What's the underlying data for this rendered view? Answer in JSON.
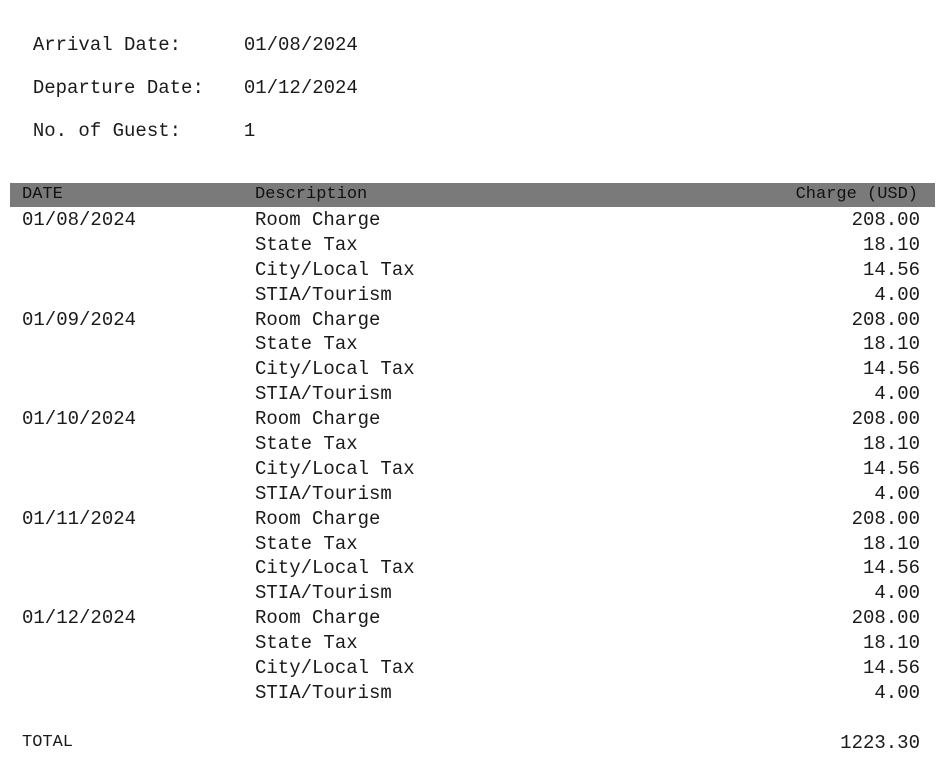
{
  "stay": {
    "arrival_label": "Arrival Date:",
    "arrival_value": "01/08/2024",
    "departure_label": "Departure Date:",
    "departure_value": "01/12/2024",
    "guests_label": "No. of Guest:",
    "guests_value": "1"
  },
  "table": {
    "headers": {
      "date": "DATE",
      "description": "Description",
      "charge": "Charge (USD)"
    },
    "rows": [
      {
        "date": "01/08/2024",
        "description": "Room Charge",
        "charge": "208.00"
      },
      {
        "date": "",
        "description": "State Tax",
        "charge": "18.10"
      },
      {
        "date": "",
        "description": "City/Local Tax",
        "charge": "14.56"
      },
      {
        "date": "",
        "description": "STIA/Tourism",
        "charge": "4.00"
      },
      {
        "date": "01/09/2024",
        "description": "Room Charge",
        "charge": "208.00"
      },
      {
        "date": "",
        "description": "State Tax",
        "charge": "18.10"
      },
      {
        "date": "",
        "description": "City/Local Tax",
        "charge": "14.56"
      },
      {
        "date": "",
        "description": "STIA/Tourism",
        "charge": "4.00"
      },
      {
        "date": "01/10/2024",
        "description": "Room Charge",
        "charge": "208.00"
      },
      {
        "date": "",
        "description": "State Tax",
        "charge": "18.10"
      },
      {
        "date": "",
        "description": "City/Local Tax",
        "charge": "14.56"
      },
      {
        "date": "",
        "description": "STIA/Tourism",
        "charge": "4.00"
      },
      {
        "date": "01/11/2024",
        "description": "Room Charge",
        "charge": "208.00"
      },
      {
        "date": "",
        "description": "State Tax",
        "charge": "18.10"
      },
      {
        "date": "",
        "description": "City/Local Tax",
        "charge": "14.56"
      },
      {
        "date": "",
        "description": "STIA/Tourism",
        "charge": "4.00"
      },
      {
        "date": "01/12/2024",
        "description": "Room Charge",
        "charge": "208.00"
      },
      {
        "date": "",
        "description": "State Tax",
        "charge": "18.10"
      },
      {
        "date": "",
        "description": "City/Local Tax",
        "charge": "14.56"
      },
      {
        "date": "",
        "description": "STIA/Tourism",
        "charge": "4.00"
      }
    ],
    "total_label": "TOTAL",
    "total_value": "1223.30"
  },
  "colors": {
    "header_bg": "#7a7a7a",
    "text": "#1a1a1a"
  }
}
